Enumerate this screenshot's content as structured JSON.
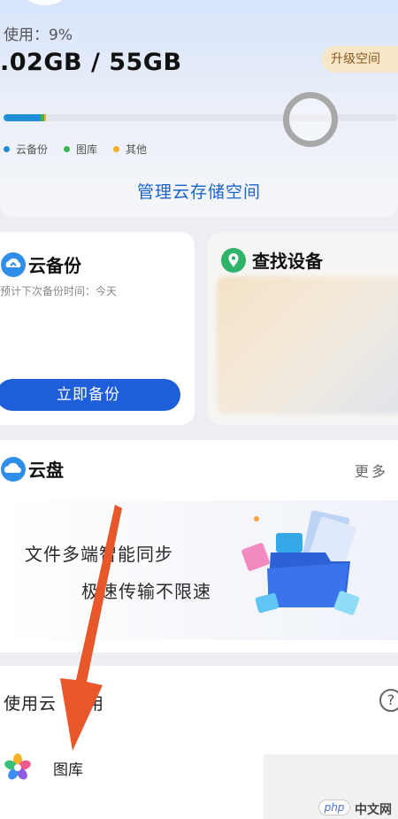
{
  "storage": {
    "usage_label": "使用：9%",
    "usage_value": ".02GB / 55GB",
    "upgrade_label": "升级空间",
    "usage_fraction": 0.09,
    "segments": [
      {
        "name": "云备份",
        "fraction": 0.095,
        "color": "#1f8fd6"
      },
      {
        "name": "图库",
        "fraction": 0.008,
        "color": "#3db356"
      },
      {
        "name": "其他",
        "fraction": 0.004,
        "color": "#f2b02d"
      }
    ],
    "legend": [
      "云备份",
      "图库",
      "其他"
    ],
    "manage_label": "管理云存储空间"
  },
  "backup_card": {
    "title": "云备份",
    "next_backup": "预计下次备份时间：今天",
    "backup_now": "立即备份",
    "icon": "cloud-backup-icon"
  },
  "find_card": {
    "title": "查找设备",
    "icon": "location-pin-icon"
  },
  "disk_card": {
    "title": "云盘",
    "more": "更多",
    "slogan_line1": "文件多端智能同步",
    "slogan_line2": "极速传输不限速",
    "icon": "cloud-disk-icon"
  },
  "use_section": {
    "title": "使用云",
    "tail": "用",
    "help": "?",
    "apps": [
      {
        "label": "图库",
        "icon": "gallery-flower-icon"
      }
    ]
  },
  "watermark": {
    "badge": "php",
    "text": "中文网"
  },
  "colors": {
    "accent": "#1e5fd9",
    "link": "#1a63c9",
    "annotation_arrow": "#e8572a"
  }
}
